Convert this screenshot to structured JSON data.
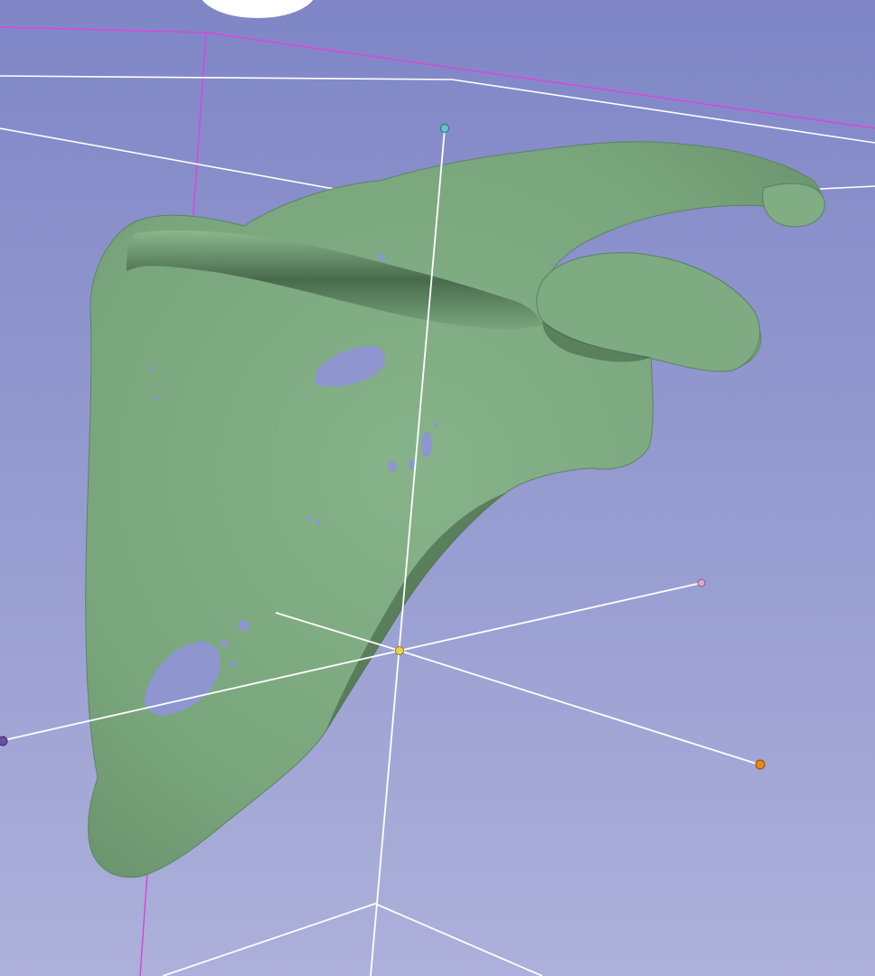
{
  "viewer": {
    "background_top": "#7f86c6",
    "background_bottom": "#acb0da",
    "model_color": "#7aa57d",
    "model_shadow": "#46694a",
    "bounding_box_color": "#d847d8",
    "axis_line_color": "#ffffff"
  },
  "markers": [
    {
      "name": "marker-cyan",
      "color": "#5fc8c8"
    },
    {
      "name": "marker-yellow",
      "color": "#e8d34a"
    },
    {
      "name": "marker-pink",
      "color": "#d9a8cc"
    },
    {
      "name": "marker-orange",
      "color": "#e88a14"
    },
    {
      "name": "marker-purple",
      "color": "#6a4fa0"
    }
  ]
}
